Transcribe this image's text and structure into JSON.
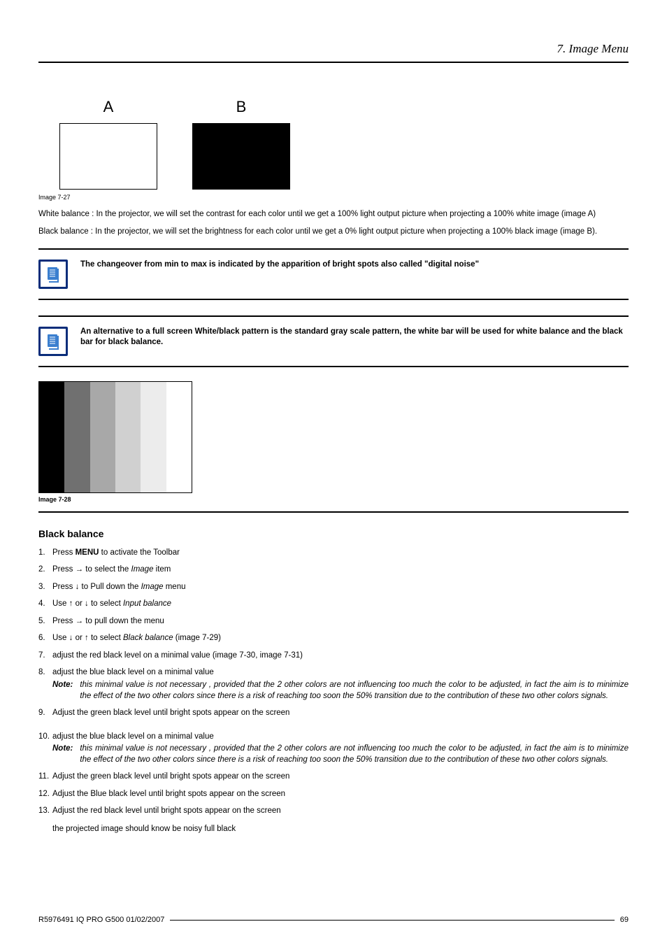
{
  "header": {
    "title": "7.  Image Menu"
  },
  "ab": {
    "a_label": "A",
    "b_label": "B",
    "caption": "Image 7-27"
  },
  "para_white": "White balance : In the projector, we will set the contrast for each color until we get a 100% light output picture when projecting a 100% white image (image A)",
  "para_black": "Black balance : In the projector, we will set the brightness for each color until we get a 0% light output picture when projecting a 100% black image (image B).",
  "info1": "The changeover from min to max is indicated by the apparition of bright spots also called \"digital noise\"",
  "info2": "An alternative to a full screen White/black pattern is the standard gray scale pattern, the white bar will be used for white balance and the black bar for black balance.",
  "grayscale_caption": "Image 7-28",
  "section_heading": "Black balance",
  "steps": [
    {
      "n": "1.",
      "pre": "Press ",
      "bold": "MENU",
      "post": " to activate the Toolbar"
    },
    {
      "n": "2.",
      "pre": "Press → to select the ",
      "italic": "Image",
      "post": " item"
    },
    {
      "n": "3.",
      "pre": "Press ↓ to Pull down the ",
      "italic": "Image",
      "post": " menu"
    },
    {
      "n": "4.",
      "pre": "Use ↑ or ↓ to select ",
      "italic": "Input balance",
      "post": ""
    },
    {
      "n": "5.",
      "pre": "Press → to pull down the menu",
      "post": ""
    },
    {
      "n": "6.",
      "pre": "Use ↓ or ↑ to select ",
      "italic": "Black balance",
      "post": " (image 7-29)"
    },
    {
      "n": "7.",
      "pre": "adjust the red black level on a minimal value (image 7-30, image 7-31)",
      "post": ""
    },
    {
      "n": "8.",
      "pre": "adjust the blue black level on a minimal value",
      "post": "",
      "note": "this minimal value is not necessary , provided that the 2 other colors are not influencing too much the color to be adjusted, in fact the aim is to minimize the effect of the two other colors since there is a risk of reaching too soon the 50% transition due to the contribution of these two other colors signals."
    },
    {
      "n": "9.",
      "pre": "Adjust the green black level until bright spots appear on the screen",
      "post": ""
    },
    {
      "n": "10.",
      "pre": "adjust the blue black level on a minimal value",
      "post": "",
      "note": "this minimal value is not necessary , provided that the 2 other colors are not influencing too much the color to be adjusted, in fact the aim is to minimize the effect of the two other colors since there is a risk of reaching too soon the 50% transition due to the contribution of these two other colors signals."
    },
    {
      "n": "11.",
      "pre": "Adjust the green black level until bright spots appear on the screen",
      "post": ""
    },
    {
      "n": "12.",
      "pre": "Adjust the Blue black level until bright spots appear on the screen",
      "post": ""
    },
    {
      "n": "13.",
      "pre": "Adjust the red black level until bright spots appear on the screen",
      "post": "",
      "after": "the projected image should know be noisy full black"
    }
  ],
  "note_label": "Note:",
  "footer": {
    "left": "R5976491  IQ PRO G500  01/02/2007",
    "right": "69"
  },
  "grayscale_colors": [
    "#000000",
    "#707070",
    "#a8a8a8",
    "#d0d0d0",
    "#ececec",
    "#ffffff"
  ]
}
